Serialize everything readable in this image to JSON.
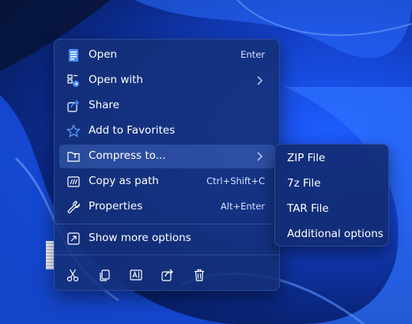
{
  "menu": {
    "items": [
      {
        "label": "Open",
        "shortcut": "Enter"
      },
      {
        "label": "Open with",
        "shortcut": ""
      },
      {
        "label": "Share",
        "shortcut": ""
      },
      {
        "label": "Add to Favorites",
        "shortcut": ""
      },
      {
        "label": "Compress to...",
        "shortcut": ""
      },
      {
        "label": "Copy as path",
        "shortcut": "Ctrl+Shift+C"
      },
      {
        "label": "Properties",
        "shortcut": "Alt+Enter"
      }
    ],
    "more_options": {
      "label": "Show more options",
      "shortcut": ""
    },
    "actions": [
      "cut-icon",
      "copy-icon",
      "rename-icon",
      "share-icon",
      "delete-icon"
    ]
  },
  "submenu": {
    "items": [
      {
        "label": "ZIP File"
      },
      {
        "label": "7z File"
      },
      {
        "label": "TAR File"
      },
      {
        "label": "Additional options"
      }
    ]
  },
  "colors": {
    "menu_bg": "#143078",
    "text": "#ffffff",
    "accent": "#4a8bff"
  }
}
